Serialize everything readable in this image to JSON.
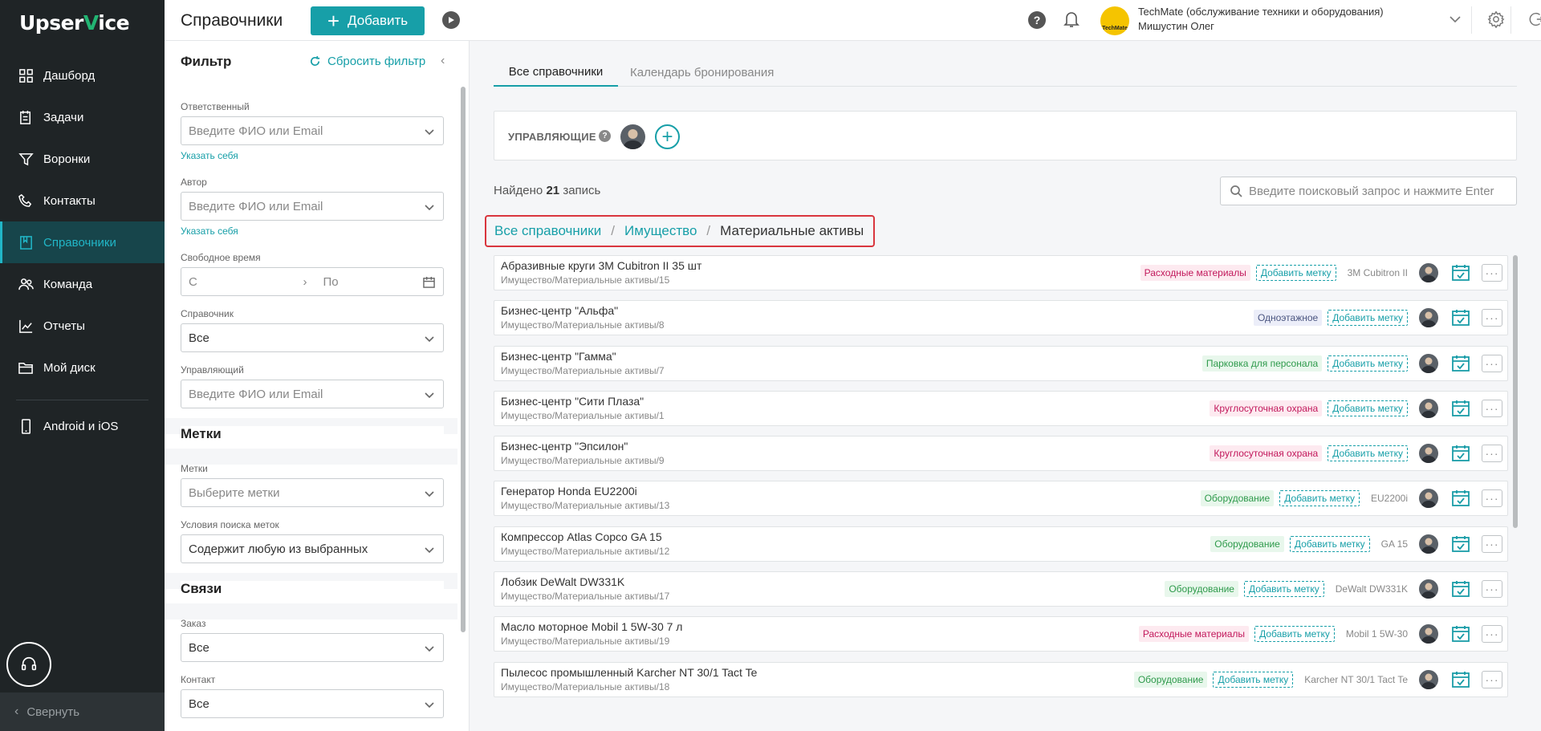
{
  "app": {
    "logo_left": "Upser",
    "logo_v": "V",
    "logo_right": "ice"
  },
  "sidebar": {
    "items": [
      {
        "label": "Дашборд",
        "icon": "dashboard-icon"
      },
      {
        "label": "Задачи",
        "icon": "tasks-icon"
      },
      {
        "label": "Воронки",
        "icon": "funnel-icon"
      },
      {
        "label": "Контакты",
        "icon": "contacts-icon"
      },
      {
        "label": "Справочники",
        "icon": "book-icon",
        "active": true
      },
      {
        "label": "Команда",
        "icon": "team-icon"
      },
      {
        "label": "Отчеты",
        "icon": "reports-icon"
      },
      {
        "label": "Мой диск",
        "icon": "folder-icon"
      }
    ],
    "mobile": {
      "label": "Android и iOS",
      "icon": "phone-icon"
    },
    "collapse_label": "Свернуть"
  },
  "topbar": {
    "title": "Справочники",
    "add_label": "Добавить",
    "company": "TechMate (обслуживание техники и оборудования)",
    "user": "Мишустин Олег",
    "company_logo_text": "TechMate"
  },
  "filter": {
    "title": "Фильтр",
    "reset": "Сбросить фильтр",
    "responsible": {
      "label": "Ответственный",
      "placeholder": "Введите ФИО или Email",
      "self": "Указать себя"
    },
    "author": {
      "label": "Автор",
      "placeholder": "Введите ФИО или Email",
      "self": "Указать себя"
    },
    "free_time": {
      "label": "Свободное время",
      "from": "С",
      "to": "По"
    },
    "directory": {
      "label": "Справочник",
      "value": "Все"
    },
    "manager": {
      "label": "Управляющий",
      "placeholder": "Введите ФИО или Email"
    },
    "tags_section": "Метки",
    "tags": {
      "label": "Метки",
      "placeholder": "Выберите метки"
    },
    "tag_condition": {
      "label": "Условия поиска меток",
      "value": "Содержит любую из выбранных"
    },
    "links_section": "Связи",
    "order": {
      "label": "Заказ",
      "value": "Все"
    },
    "contact": {
      "label": "Контакт",
      "value": "Все"
    }
  },
  "main": {
    "tabs": [
      "Все справочники",
      "Календарь бронирования"
    ],
    "managers_label": "УПРАВЛЯЮЩИЕ",
    "found_prefix": "Найдено",
    "found_count": "21",
    "found_suffix": "запись",
    "search_placeholder": "Введите поисковый запрос и нажмите Enter",
    "breadcrumbs": [
      "Все справочники",
      "Имущество",
      "Материальные активы"
    ],
    "add_tag_label": "Добавить метку",
    "rows": [
      {
        "title": "Абразивные круги 3M Cubitron II 35 шт",
        "path": "Имущество/Материальные активы/15",
        "tag": "Расходные материалы",
        "tag_color": "pink",
        "model": "3M Cubitron II"
      },
      {
        "title": "Бизнес-центр \"Альфа\"",
        "path": "Имущество/Материальные активы/8",
        "tag": "Одноэтажное",
        "tag_color": "blue",
        "model": ""
      },
      {
        "title": "Бизнес-центр \"Гамма\"",
        "path": "Имущество/Материальные активы/7",
        "tag": "Парковка для персонала",
        "tag_color": "green",
        "model": ""
      },
      {
        "title": "Бизнес-центр \"Сити Плаза\"",
        "path": "Имущество/Материальные активы/1",
        "tag": "Круглосуточная охрана",
        "tag_color": "pink",
        "model": ""
      },
      {
        "title": "Бизнес-центр \"Эпсилон\"",
        "path": "Имущество/Материальные активы/9",
        "tag": "Круглосуточная охрана",
        "tag_color": "pink",
        "model": ""
      },
      {
        "title": "Генератор Honda EU2200i",
        "path": "Имущество/Материальные активы/13",
        "tag": "Оборудование",
        "tag_color": "green",
        "model": "EU2200i"
      },
      {
        "title": "Компрессор Atlas Copco GA 15",
        "path": "Имущество/Материальные активы/12",
        "tag": "Оборудование",
        "tag_color": "green",
        "model": "GA 15"
      },
      {
        "title": "Лобзик DeWalt DW331K",
        "path": "Имущество/Материальные активы/17",
        "tag": "Оборудование",
        "tag_color": "green",
        "model": "DeWalt DW331K"
      },
      {
        "title": "Масло моторное Mobil 1 5W-30 7 л",
        "path": "Имущество/Материальные активы/19",
        "tag": "Расходные материалы",
        "tag_color": "pink",
        "model": "Mobil 1 5W-30"
      },
      {
        "title": "Пылесос промышленный Karcher NT 30/1 Tact Te",
        "path": "Имущество/Материальные активы/18",
        "tag": "Оборудование",
        "tag_color": "green",
        "model": "Karcher NT 30/1 Tact Te"
      }
    ]
  },
  "colors": {
    "accent": "#179fa8",
    "sidebar_bg": "#1f2426",
    "highlight": "#d9363e"
  }
}
